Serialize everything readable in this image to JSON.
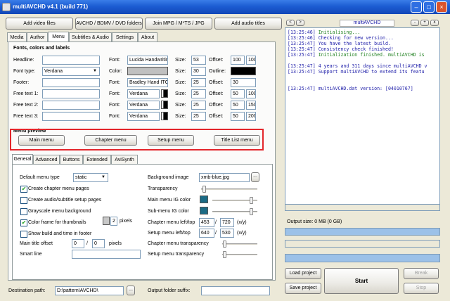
{
  "window": {
    "title": "multiAVCHD v4.1 (build 771)"
  },
  "toolbar": {
    "add_video": "Add video files",
    "avchd_folders": "AVCHD / BDMV / DVD folders",
    "join_mpg": "Join MPG / M*TS / JPG",
    "add_audio": "Add audio titles"
  },
  "tabs": [
    "Media",
    "Author",
    "Menu",
    "Subtitles & Audio",
    "Settings",
    "About"
  ],
  "fonts_section": {
    "title": "Fonts, colors and labels",
    "font_label": "Font:",
    "size_label": "Size:",
    "offset_label": "Offset:",
    "color_label": "Color:",
    "outline_label": "Outline:",
    "rows": [
      {
        "label": "Headline:",
        "value": "",
        "font": "Lucida Handwriting",
        "size": "53",
        "offset_x": "100",
        "offset_y": "100"
      },
      {
        "label": "Font type:",
        "value": "Verdana",
        "font": "",
        "size": "30",
        "offset_x": "",
        "offset_y": ""
      },
      {
        "label": "Footer:",
        "value": "",
        "font": "Bradley Hand ITC",
        "size": "25",
        "offset_x": "30",
        "offset_y": ""
      },
      {
        "label": "Free text 1:",
        "value": "",
        "font": "Verdana",
        "size": "25",
        "offset_x": "50",
        "offset_y": "100"
      },
      {
        "label": "Free text 2:",
        "value": "",
        "font": "Verdana",
        "size": "25",
        "offset_x": "50",
        "offset_y": "150"
      },
      {
        "label": "Free text 3:",
        "value": "",
        "font": "Verdana",
        "size": "25",
        "offset_x": "50",
        "offset_y": "200"
      }
    ]
  },
  "menu_preview": {
    "title": "Menu preview",
    "buttons": [
      "Main menu",
      "Chapter menu",
      "Setup menu",
      "Title List menu"
    ]
  },
  "subtabs": [
    "General",
    "Advanced",
    "Buttons",
    "Extended",
    "AviSynth"
  ],
  "general": {
    "default_menu_type_label": "Default menu type",
    "default_menu_type": "static",
    "checks": [
      {
        "label": "Create chapter menu pages",
        "checked": true
      },
      {
        "label": "Create audio/subtitle setup pages",
        "checked": false
      },
      {
        "label": "Grayscale menu background",
        "checked": false
      },
      {
        "label": "Color frame for thumbnails",
        "checked": true
      },
      {
        "label": "Show build and time in footer",
        "checked": false
      }
    ],
    "pixels_value": "2",
    "pixels_label": "pixels",
    "main_title_offset_label": "Main title offset",
    "main_title_offset_x": "0",
    "main_title_offset_y": "0",
    "main_title_offset_unit": "pixels",
    "smart_line_label": "Smart line",
    "smart_line_value": ""
  },
  "right_settings": {
    "background_image_label": "Background image",
    "background_image": "xmb-blue.jpg",
    "transparency_label": "Transparency",
    "transparency_level": 0.02,
    "main_menu_color_label": "Main menu IG color",
    "main_menu_color_level": 0.9,
    "sub_menu_color_label": "Sub-menu IG color",
    "sub_menu_color_level": 0.9,
    "color_swatch": "#1b6b85",
    "chapter_left_top_label": "Chapter menu left/top",
    "chapter_left": "453",
    "chapter_top": "720",
    "setup_left_top_label": "Setup menu left/top",
    "setup_left": "640",
    "setup_top": "530",
    "xy_label": "(x/y)",
    "chapter_transparency_label": "Chapter menu transparency",
    "chapter_transparency_level": 0.02,
    "setup_transparency_label": "Setup menu transparency",
    "setup_transparency_level": 0.02
  },
  "bottom": {
    "destination_label": "Destination path:",
    "destination_value": "D:\\pattern\\AVCHD\\",
    "browse": "...",
    "suffix_label": "Output folder suffix:",
    "suffix_value": ""
  },
  "log_panel": {
    "title": "multiAVCHD",
    "nav_prev": "<",
    "nav_next": ">",
    "ctrl_minus": "-",
    "ctrl_plus": "+",
    "ctrl_close": "x",
    "lines": [
      {
        "time": "[13:25:46]",
        "text": "Initialising...",
        "color": "#208020"
      },
      {
        "time": "[13:25:46]",
        "text": "Checking for new version...",
        "color": "#1c1ca8"
      },
      {
        "time": "[13:25:47]",
        "text": "You have the latest build.",
        "color": "#1c1ca8"
      },
      {
        "time": "[13:25:47]",
        "text": "Consistency check finished!",
        "color": "#1c1ca8"
      },
      {
        "time": "[13:25:47]",
        "text": "Initialization finished. multiAVCHD is",
        "color": "#208020"
      },
      {
        "time": "",
        "text": "",
        "color": "#000"
      },
      {
        "time": "[13:25:47]",
        "text": "4 years and 311 days since multiAVCHD v",
        "color": "#1c1ca8"
      },
      {
        "time": "[13:25:47]",
        "text": "Support multiAVCHD to extend its featu",
        "color": "#1c1ca8"
      },
      {
        "time": "",
        "text": "",
        "color": "#000"
      },
      {
        "time": "",
        "text": "",
        "color": "#000"
      },
      {
        "time": "[13:25:47]",
        "text": "multiAVCHD.dat version: [04010767]",
        "color": "#1c1ca8"
      }
    ]
  },
  "output": {
    "size_text": "Output size: 0 MB (0 GB)",
    "load_project": "Load project",
    "save_project": "Save project",
    "start": "Start",
    "break": "Break",
    "stop": "Stop"
  },
  "colors": {
    "accent_highlight": "#e3262b",
    "progress_blue": "#9cc1e8"
  }
}
